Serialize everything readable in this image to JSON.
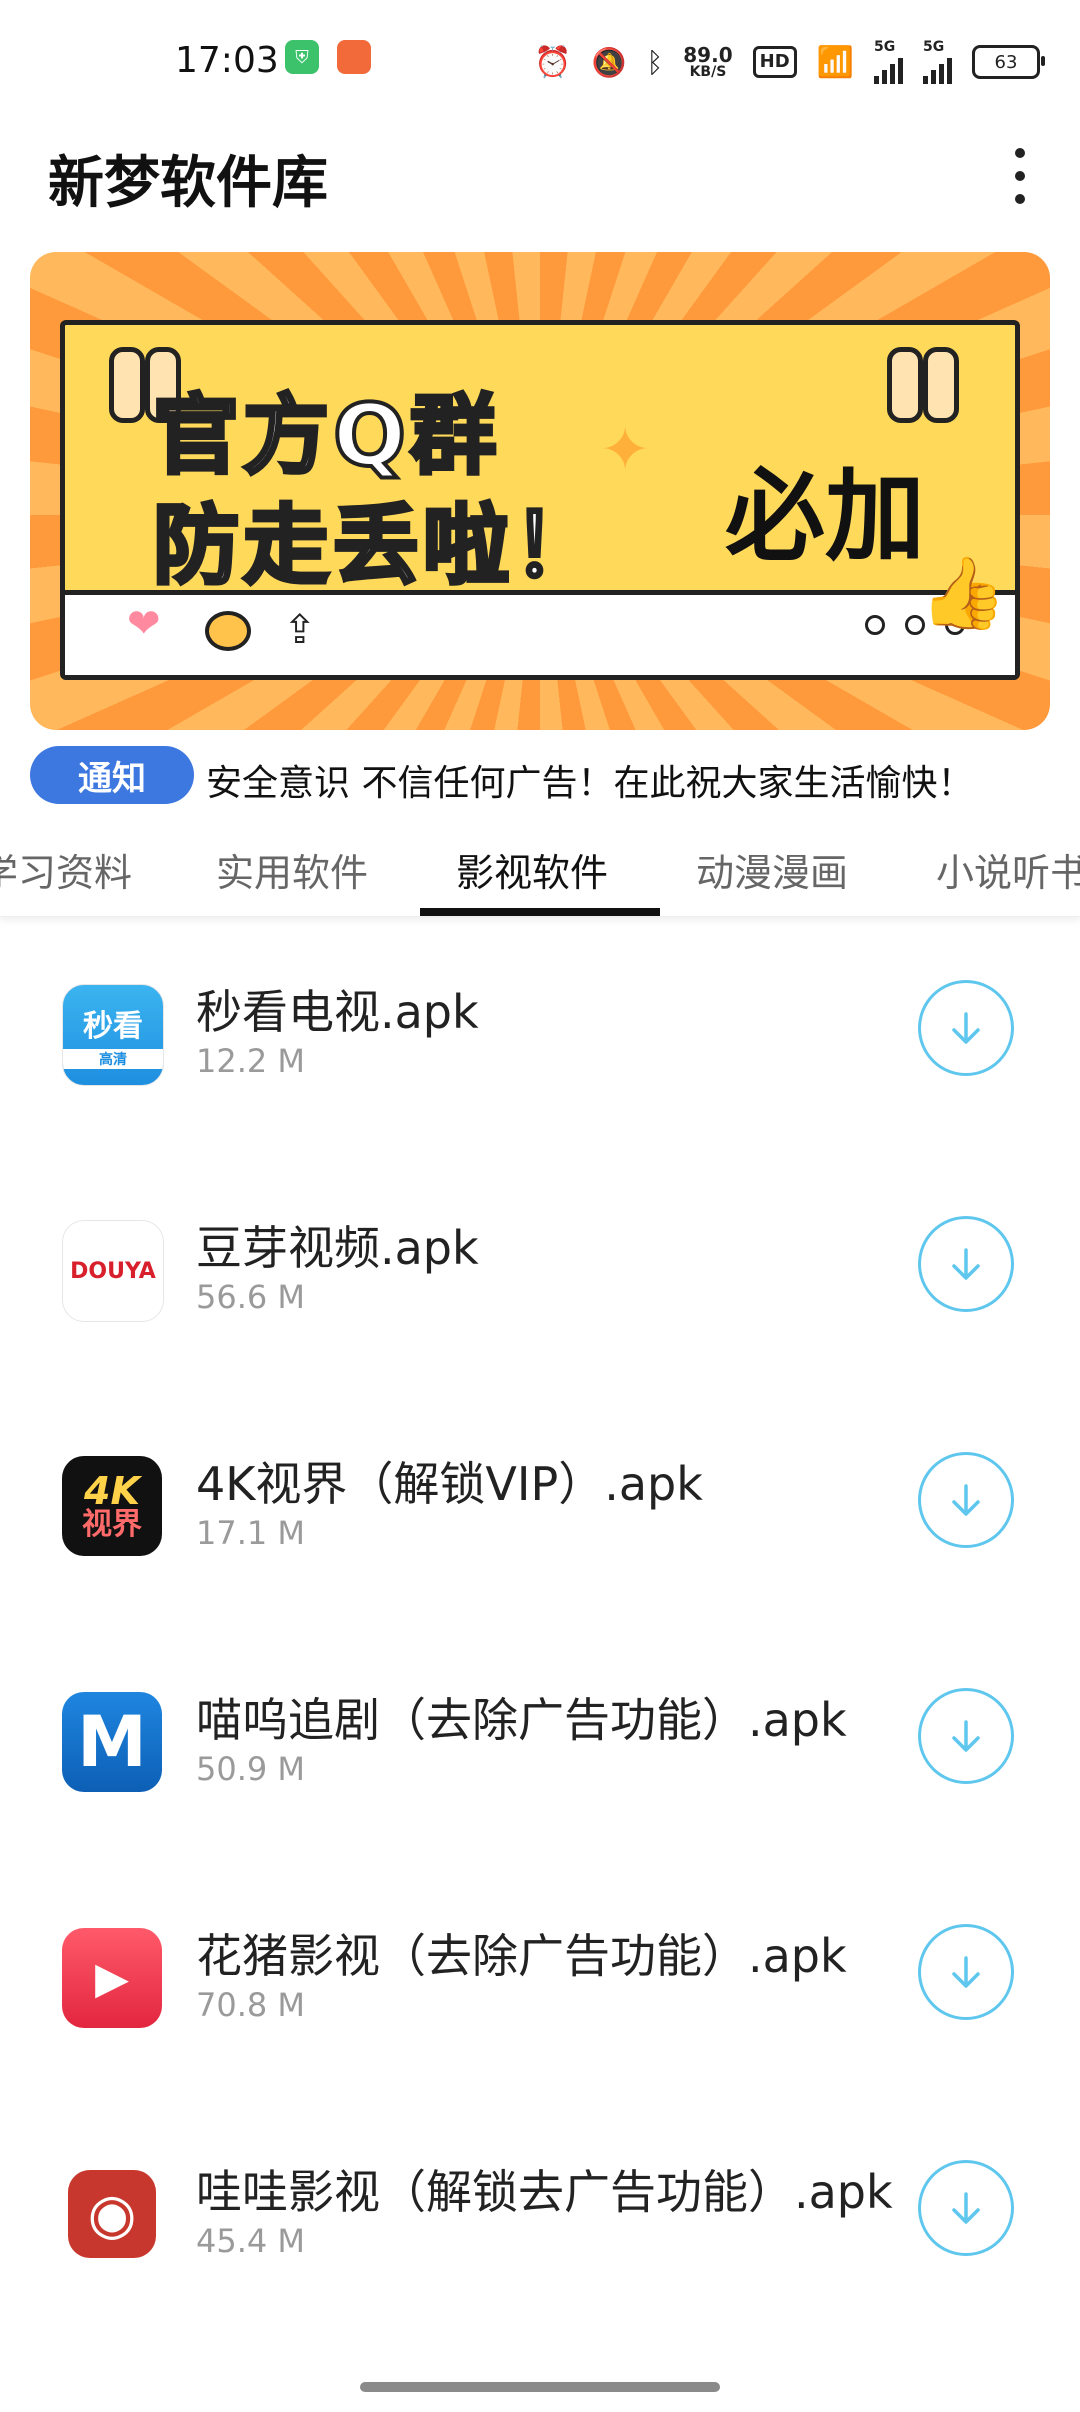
{
  "status_bar": {
    "time": "17:03",
    "net_speed_value": "89.0",
    "net_speed_unit": "KB/S",
    "hd_label": "HD",
    "signal_label": "5G",
    "battery": "63"
  },
  "app_bar": {
    "title": "新梦软件库"
  },
  "banner": {
    "line1": "官方Q群",
    "line2": "防走丢啦！",
    "side_text": "必加"
  },
  "notice": {
    "badge": "通知",
    "text": "安全意识 不信任何广告！在此祝大家生活愉快！"
  },
  "tabs": [
    {
      "label": "学习资料"
    },
    {
      "label": "实用软件"
    },
    {
      "label": "影视软件"
    },
    {
      "label": "动漫漫画"
    },
    {
      "label": "小说听书"
    }
  ],
  "apps": [
    {
      "name": "秒看电视.apk",
      "size": "12.2 M",
      "icon_text": "秒看",
      "icon_sub": "高清"
    },
    {
      "name": "豆芽视频.apk",
      "size": "56.6 M",
      "icon_text": "DOUYA"
    },
    {
      "name": "4K视界（解锁VIP）.apk",
      "size": "17.1 M",
      "icon_text": "4K",
      "icon_sub": "视界"
    },
    {
      "name": "喵呜追剧（去除广告功能）.apk",
      "size": "50.9 M",
      "icon_text": "M"
    },
    {
      "name": "花猪影视（去除广告功能）.apk",
      "size": "70.8 M",
      "icon_text": "▶"
    },
    {
      "name": "哇哇影视（解锁去广告功能）.apk",
      "size": "45.4 M",
      "icon_text": "◉"
    }
  ]
}
